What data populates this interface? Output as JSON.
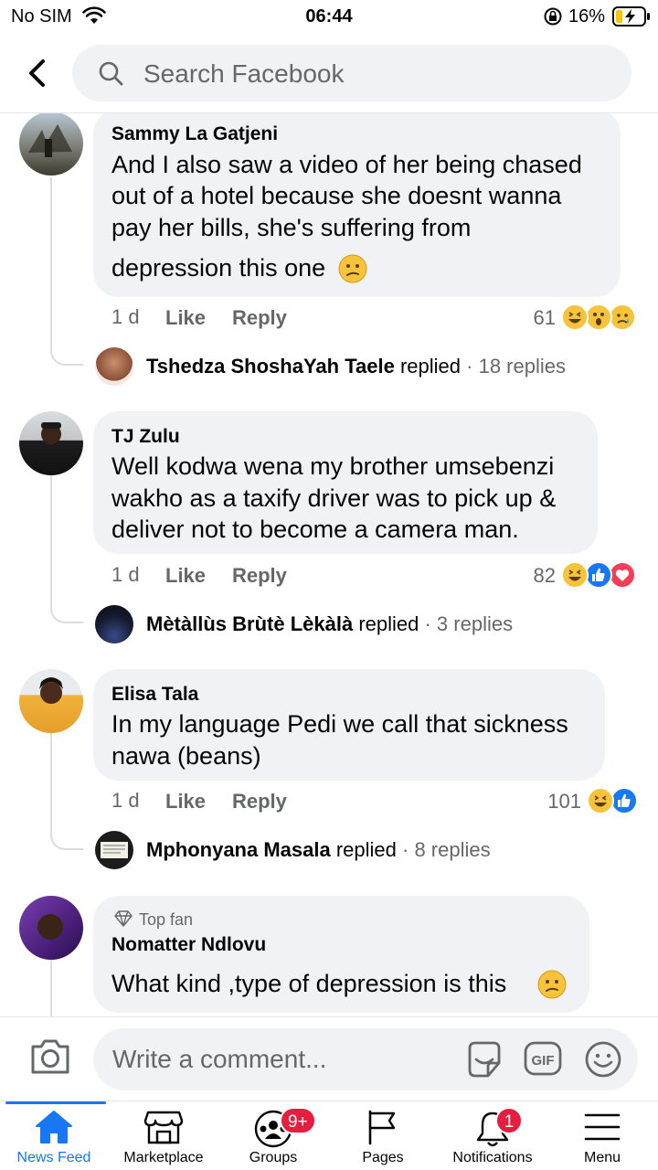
{
  "status_bar": {
    "carrier": "No SIM",
    "time": "06:44",
    "battery": "16%"
  },
  "header": {
    "search_placeholder": "Search Facebook"
  },
  "comments": [
    {
      "author": "Sammy La Gatjeni",
      "lines": [
        "And I also saw a video of her being chased",
        "out of a hotel because she doesnt wanna",
        "pay her bills, she's suffering from",
        "depression this one"
      ],
      "time": "1 d",
      "like": "Like",
      "reply": "Reply",
      "reaction_count": "61",
      "reactions": [
        "haha",
        "wow",
        "sad"
      ],
      "replied_by": "Tshedza ShoshaYah Taele",
      "replied_word": "replied",
      "replies": "· 18 replies"
    },
    {
      "author": "TJ Zulu",
      "lines": [
        "Well kodwa wena my brother umsebenzi",
        "wakho as a taxify driver was to pick up &",
        "deliver not to become a camera man."
      ],
      "time": "1 d",
      "like": "Like",
      "reply": "Reply",
      "reaction_count": "82",
      "reactions": [
        "haha",
        "like",
        "love"
      ],
      "replied_by": "Mètàllùs Brùtè Lèkàlà",
      "replied_word": "replied",
      "replies": "· 3 replies"
    },
    {
      "author": "Elisa Tala",
      "lines": [
        "In my language Pedi we call that sickness",
        "nawa (beans)"
      ],
      "time": "1 d",
      "like": "Like",
      "reply": "Reply",
      "reaction_count": "101",
      "reactions": [
        "haha",
        "like"
      ],
      "replied_by": "Mphonyana Masala",
      "replied_word": "replied",
      "replies": "· 8 replies"
    },
    {
      "badge": "Top fan",
      "author": "Nomatter Ndlovu",
      "lines": [
        "What kind ,type of depression is this"
      ]
    }
  ],
  "composer": {
    "placeholder": "Write a comment...",
    "gif": "GIF"
  },
  "tabs": [
    {
      "label": "News Feed",
      "icon": "home-icon",
      "active": true
    },
    {
      "label": "Marketplace",
      "icon": "marketplace-icon"
    },
    {
      "label": "Groups",
      "icon": "groups-icon",
      "badge": "9+"
    },
    {
      "label": "Pages",
      "icon": "pages-icon"
    },
    {
      "label": "Notifications",
      "icon": "bell-icon",
      "badge": "1"
    },
    {
      "label": "Menu",
      "icon": "menu-icon"
    }
  ],
  "colors": {
    "accent": "#1877f2",
    "bubble": "#f0f2f5",
    "badge": "#e41e3f",
    "secondary_text": "#65676b"
  }
}
